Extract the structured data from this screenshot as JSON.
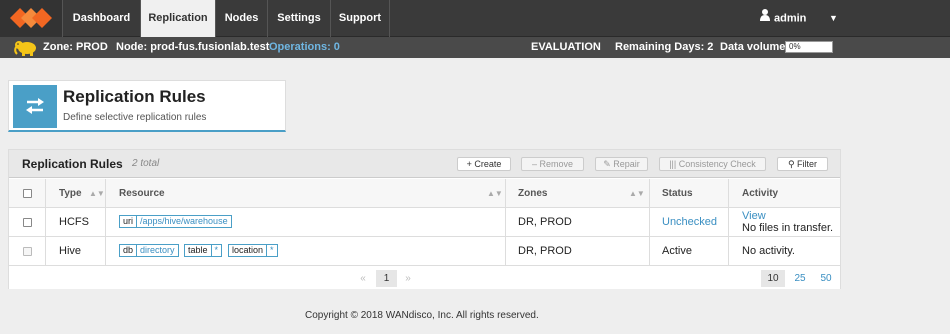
{
  "nav": {
    "tabs": [
      {
        "label": "Dashboard"
      },
      {
        "label": "Replication"
      },
      {
        "label": "Nodes"
      },
      {
        "label": "Settings"
      },
      {
        "label": "Support"
      }
    ],
    "user": "admin"
  },
  "status": {
    "zone": "Zone: PROD",
    "node": "Node: prod-fus.fusionlab.test",
    "operations": "Operations: 0",
    "edition": "EVALUATION",
    "remaining": "Remaining Days: 2",
    "volume_label": "Data volume:",
    "volume_value": "0%"
  },
  "header": {
    "title": "Replication Rules",
    "subtitle": "Define selective replication rules"
  },
  "panel": {
    "title": "Replication Rules",
    "count": "2 total",
    "buttons": {
      "create": "+ Create",
      "remove": "– Remove",
      "repair": "Repair",
      "consistency": "Consistency Check",
      "filter": "Filter"
    }
  },
  "table": {
    "columns": [
      "Type",
      "Resource",
      "Zones",
      "Status",
      "Activity"
    ],
    "rows": [
      {
        "type": "HCFS",
        "resource": [
          {
            "key": "uri",
            "value": "/apps/hive/warehouse"
          }
        ],
        "zones": "DR, PROD",
        "status": "Unchecked",
        "activity_link": "View",
        "activity": "No files in transfer."
      },
      {
        "type": "Hive",
        "resource": [
          {
            "key": "db",
            "value": "directory"
          },
          {
            "key": "table",
            "value": "*"
          },
          {
            "key": "location",
            "value": "*"
          }
        ],
        "zones": "DR, PROD",
        "status": "Active",
        "activity": "No activity."
      }
    ]
  },
  "pager": {
    "first": "«",
    "current": "1",
    "last": "»",
    "sizes": [
      "10",
      "25",
      "50"
    ]
  },
  "footer": {
    "copyright": "Copyright © 2018 WANdisco, Inc. All rights reserved."
  },
  "colors": {
    "accent": "#4a9fc7",
    "link": "#3a8fc2",
    "logo": "#f26722"
  }
}
